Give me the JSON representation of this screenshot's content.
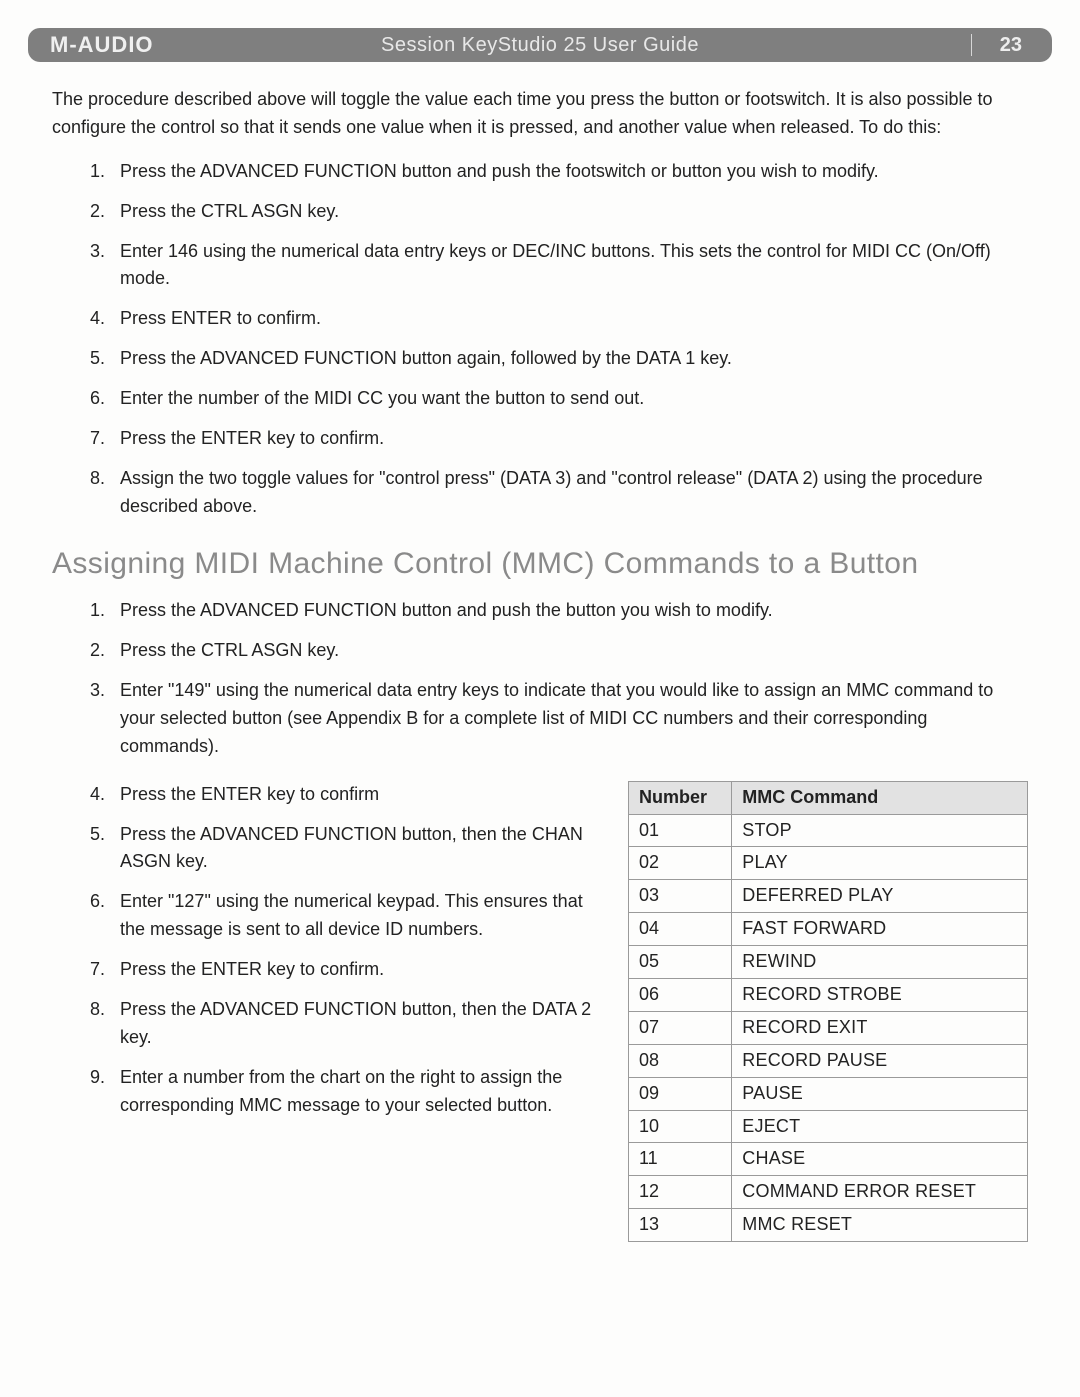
{
  "header": {
    "brand": "M-AUDIO",
    "title": "Session KeyStudio 25 User Guide",
    "page": "23"
  },
  "intro_text": "The procedure described above will toggle the value each time you press the button or footswitch. It is also possible to configure the control so that it sends one value when it is pressed, and another value when released. To do this:",
  "steps_a": [
    "Press the ADVANCED FUNCTION button and push the footswitch or button you wish to modify.",
    "Press the CTRL ASGN key.",
    "Enter 146 using the numerical data entry keys or DEC/INC buttons. This sets the control for MIDI CC (On/Off) mode.",
    "Press ENTER to confirm.",
    "Press the ADVANCED FUNCTION button again, followed by the DATA 1 key.",
    "Enter the number of the MIDI CC you want the button to send out.",
    "Press the ENTER key to confirm.",
    "Assign the two toggle values for \"control press\" (DATA 3) and \"control release\" (DATA 2) using the procedure described above."
  ],
  "section_b_title": "Assigning MIDI Machine Control (MMC) Commands to a Button",
  "steps_b_top": [
    "Press the ADVANCED FUNCTION button and push the button you wish to modify.",
    "Press the CTRL ASGN key.",
    "Enter \"149\" using the numerical data entry keys to indicate that you would like to assign an MMC command to your selected button (see Appendix B for a complete list of MIDI CC numbers and their corresponding commands)."
  ],
  "steps_b_left": [
    "Press the ENTER key to confirm",
    "Press the ADVANCED FUNCTION button, then the CHAN ASGN key.",
    "Enter \"127\" using the numerical keypad. This ensures that the message is sent to all device ID numbers.",
    "Press the ENTER key to confirm.",
    "Press the ADVANCED FUNCTION button, then the DATA 2 key.",
    "Enter a number from the chart on the right to assign the corresponding MMC message to your selected button."
  ],
  "mmc_table": {
    "headers": {
      "num": "Number",
      "cmd": "MMC Command"
    },
    "rows": [
      {
        "num": "01",
        "cmd": "STOP"
      },
      {
        "num": "02",
        "cmd": "PLAY"
      },
      {
        "num": "03",
        "cmd": "DEFERRED PLAY"
      },
      {
        "num": "04",
        "cmd": "FAST FORWARD"
      },
      {
        "num": "05",
        "cmd": "REWIND"
      },
      {
        "num": "06",
        "cmd": "RECORD STROBE"
      },
      {
        "num": "07",
        "cmd": "RECORD EXIT"
      },
      {
        "num": "08",
        "cmd": "RECORD PAUSE"
      },
      {
        "num": "09",
        "cmd": "PAUSE"
      },
      {
        "num": "10",
        "cmd": "EJECT"
      },
      {
        "num": "11",
        "cmd": "CHASE"
      },
      {
        "num": "12",
        "cmd": "COMMAND ERROR RESET"
      },
      {
        "num": "13",
        "cmd": "MMC RESET"
      }
    ]
  }
}
